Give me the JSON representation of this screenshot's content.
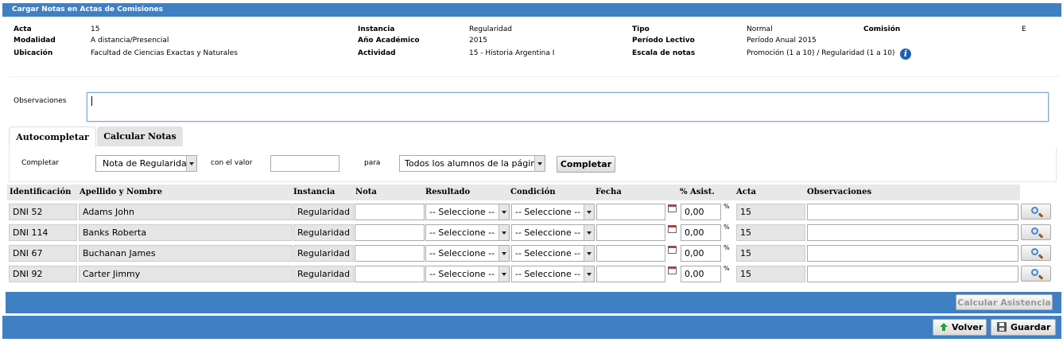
{
  "title": "Cargar Notas en Actas de Comisiones",
  "header": {
    "acta_label": "Acta",
    "acta_value": "15",
    "modalidad_label": "Modalidad",
    "modalidad_value": "A distancia/Presencial",
    "ubicacion_label": "Ubicación",
    "ubicacion_value": "Facultad de Ciencias Exactas y Naturales",
    "instancia_label": "Instancia",
    "instancia_value": "Regularidad",
    "anio_label": "Año Académico",
    "anio_value": "2015",
    "actividad_label": "Actividad",
    "actividad_value": "15 - Historia Argentina I",
    "tipo_label": "Tipo",
    "tipo_value": "Normal",
    "periodo_label": "Período Lectivo",
    "periodo_value": "Período Anual 2015",
    "escala_label": "Escala de notas",
    "escala_value": "Promoción (1 a 10) / Regularidad (1 a 10)",
    "comision_label": "Comisión",
    "comision_value": "E"
  },
  "observaciones": {
    "label": "Observaciones",
    "value": ""
  },
  "tabs": [
    {
      "label": "Autocompletar",
      "active": true
    },
    {
      "label": "Calcular Notas",
      "active": false
    }
  ],
  "autocompletar": {
    "completar_label": "Completar",
    "field_select": "Nota de Regularidad",
    "con_valor_label": "con el valor",
    "valor": "",
    "para_label": "para",
    "target_select": "Todos los alumnos de la página",
    "button": "Completar"
  },
  "grid": {
    "columns": [
      "Identificación",
      "Apellido y Nombre",
      "Instancia",
      "Nota",
      "Resultado",
      "Condición",
      "Fecha",
      "% Asist.",
      "Acta",
      "Observaciones"
    ],
    "rows": [
      {
        "id": "DNI 52",
        "name": "Adams John",
        "instancia": "Regularidad",
        "nota": "",
        "resultado": "-- Seleccione --",
        "condicion": "-- Seleccione --",
        "fecha": "",
        "asist": "0,00",
        "pct": "%",
        "acta": "15",
        "obs": ""
      },
      {
        "id": "DNI 114",
        "name": "Banks Roberta",
        "instancia": "Regularidad",
        "nota": "",
        "resultado": "-- Seleccione --",
        "condicion": "-- Seleccione --",
        "fecha": "",
        "asist": "0,00",
        "pct": "%",
        "acta": "15",
        "obs": ""
      },
      {
        "id": "DNI 67",
        "name": "Buchanan James",
        "instancia": "Regularidad",
        "nota": "",
        "resultado": "-- Seleccione --",
        "condicion": "-- Seleccione --",
        "fecha": "",
        "asist": "0,00",
        "pct": "%",
        "acta": "15",
        "obs": ""
      },
      {
        "id": "DNI 92",
        "name": "Carter Jimmy",
        "instancia": "Regularidad",
        "nota": "",
        "resultado": "-- Seleccione --",
        "condicion": "-- Seleccione --",
        "fecha": "",
        "asist": "0,00",
        "pct": "%",
        "acta": "15",
        "obs": ""
      }
    ]
  },
  "footer": {
    "calcular_asistencia": "Calcular Asistencia",
    "volver": "Volver",
    "guardar": "Guardar"
  },
  "colors": {
    "accent": "#3f7fc3",
    "info_icon": "#1d5fb4"
  }
}
